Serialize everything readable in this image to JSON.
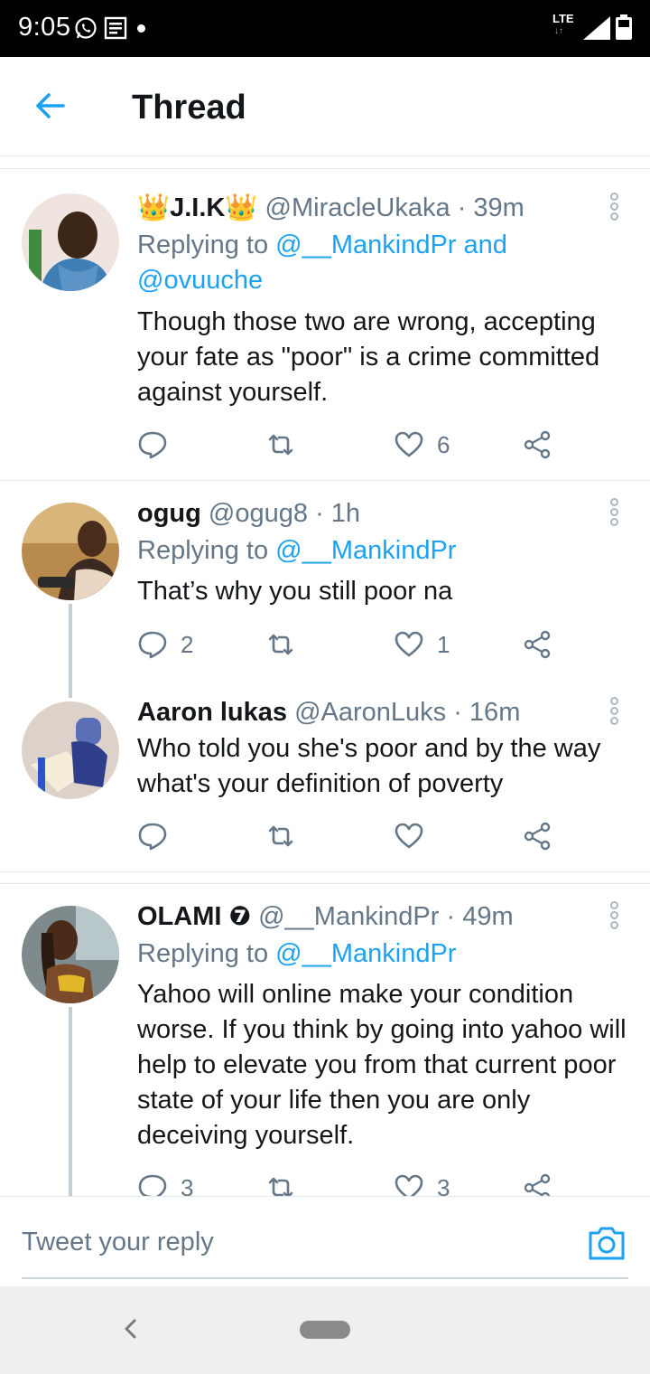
{
  "status_bar": {
    "time": "9:05",
    "network": "LTE"
  },
  "header": {
    "title": "Thread"
  },
  "tweets": [
    {
      "name": "👑J.I.K👑",
      "handle": "@MiracleUkaka",
      "time": "· 39m",
      "replying_prefix": "Replying to ",
      "replying_mention1": "@__MankindPr",
      "replying_and": " and",
      "replying_mention2": "@ovuuche",
      "text": "Though those two are wrong, accepting your fate as \"poor\" is a crime committed against yourself.",
      "replies": "",
      "retweets": "",
      "likes": "6"
    },
    {
      "name": "ogug",
      "handle": "@ogug8",
      "time": "· 1h",
      "replying_prefix": "Replying to ",
      "replying_mention1": "@__MankindPr",
      "text": "That’s why you still poor na",
      "replies": "2",
      "retweets": "",
      "likes": "1"
    },
    {
      "name": "Aaron lukas",
      "handle": "@AaronLuks",
      "time": "· 16m",
      "text": "Who told you she's poor and by the way what's your definition of poverty",
      "replies": "",
      "retweets": "",
      "likes": ""
    },
    {
      "name": "OLAMI ❼",
      "handle": "@__MankindPr",
      "time": "· 49m",
      "replying_prefix": "Replying to ",
      "replying_mention1": "@__MankindPr",
      "text": "Yahoo will online make your condition worse. If you think by going into yahoo will help to elevate you from that current poor state of your life then you are only deceiving yourself.",
      "replies": "3",
      "retweets": "",
      "likes": "3"
    }
  ],
  "reply_bar": {
    "placeholder": "Tweet your reply"
  },
  "icons": {
    "back": "arrow-left-icon",
    "reply": "speech-bubble-icon",
    "retweet": "retweet-icon",
    "like": "heart-icon",
    "share": "share-icon",
    "more": "more-vertical-icon",
    "camera": "camera-icon"
  },
  "colors": {
    "accent": "#1da1f2",
    "secondary_text": "#657786",
    "primary_text": "#14171a"
  }
}
